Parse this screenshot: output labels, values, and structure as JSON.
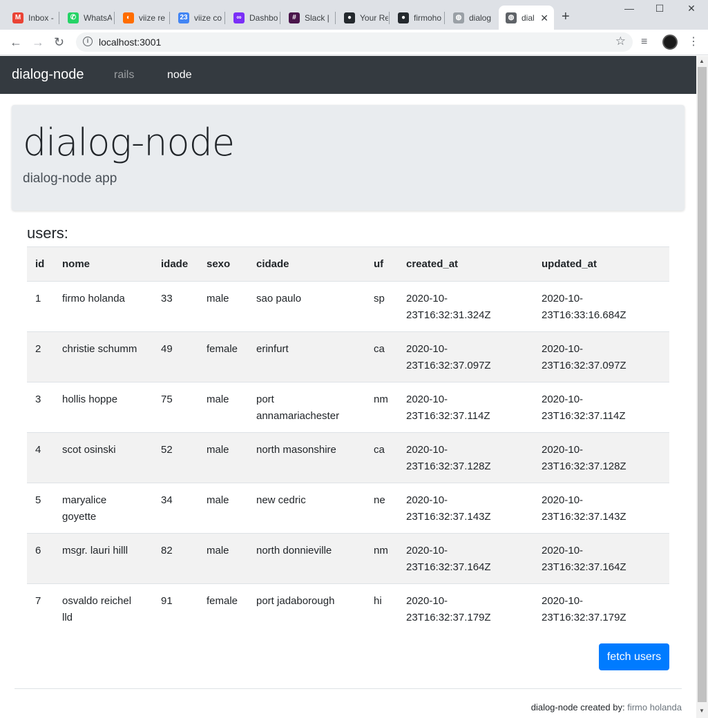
{
  "browser": {
    "tabs": [
      {
        "title": "Inbox -",
        "icon": "gmail-icon",
        "color": "#ea4335",
        "glyph": "M"
      },
      {
        "title": "WhatsA",
        "icon": "whatsapp-icon",
        "color": "#25d366",
        "glyph": "✆"
      },
      {
        "title": "viize re",
        "icon": "viize-icon",
        "color": "#ff6d00",
        "glyph": "◐"
      },
      {
        "title": "viize co",
        "icon": "calendar-icon",
        "color": "#4285f4",
        "glyph": "23"
      },
      {
        "title": "Dashbo",
        "icon": "dashboard-icon",
        "color": "#7b2ff7",
        "glyph": "∞"
      },
      {
        "title": "Slack |",
        "icon": "slack-icon",
        "color": "#4a154b",
        "glyph": "#"
      },
      {
        "title": "Your Re",
        "icon": "github-icon",
        "color": "#24292e",
        "glyph": "●"
      },
      {
        "title": "firmoho",
        "icon": "github-icon",
        "color": "#24292e",
        "glyph": "●"
      },
      {
        "title": "dialog",
        "icon": "globe-icon",
        "color": "#9aa0a6",
        "glyph": "◍"
      },
      {
        "title": "dial",
        "icon": "globe-icon",
        "color": "#5f6368",
        "glyph": "◍"
      }
    ],
    "url": "localhost:3001"
  },
  "navbar": {
    "brand": "dialog-node",
    "links": [
      "rails",
      "node"
    ]
  },
  "jumbotron": {
    "title": "dialog-node",
    "lead": "dialog-node app"
  },
  "users": {
    "title": "users:",
    "columns": [
      "id",
      "nome",
      "idade",
      "sexo",
      "cidade",
      "uf",
      "created_at",
      "updated_at"
    ],
    "rows": [
      [
        "1",
        "firmo holanda",
        "33",
        "male",
        "sao paulo",
        "sp",
        "2020-10-\n23T16:32:31.324Z",
        "2020-10-\n23T16:33:16.684Z"
      ],
      [
        "2",
        "christie schumm",
        "49",
        "female",
        "erinfurt",
        "ca",
        "2020-10-\n23T16:32:37.097Z",
        "2020-10-\n23T16:32:37.097Z"
      ],
      [
        "3",
        "hollis hoppe",
        "75",
        "male",
        "port\nannamariachester",
        "nm",
        "2020-10-\n23T16:32:37.114Z",
        "2020-10-\n23T16:32:37.114Z"
      ],
      [
        "4",
        "scot osinski",
        "52",
        "male",
        "north masonshire",
        "ca",
        "2020-10-\n23T16:32:37.128Z",
        "2020-10-\n23T16:32:37.128Z"
      ],
      [
        "5",
        "maryalice\ngoyette",
        "34",
        "male",
        "new cedric",
        "ne",
        "2020-10-\n23T16:32:37.143Z",
        "2020-10-\n23T16:32:37.143Z"
      ],
      [
        "6",
        "msgr. lauri hilll",
        "82",
        "male",
        "north donnieville",
        "nm",
        "2020-10-\n23T16:32:37.164Z",
        "2020-10-\n23T16:32:37.164Z"
      ],
      [
        "7",
        "osvaldo reichel\nlld",
        "91",
        "female",
        "port jadaborough",
        "hi",
        "2020-10-\n23T16:32:37.179Z",
        "2020-10-\n23T16:32:37.179Z"
      ]
    ],
    "fetch_label": "fetch users"
  },
  "footer": {
    "prefix": "dialog-node created by:",
    "author": "firmo holanda"
  }
}
